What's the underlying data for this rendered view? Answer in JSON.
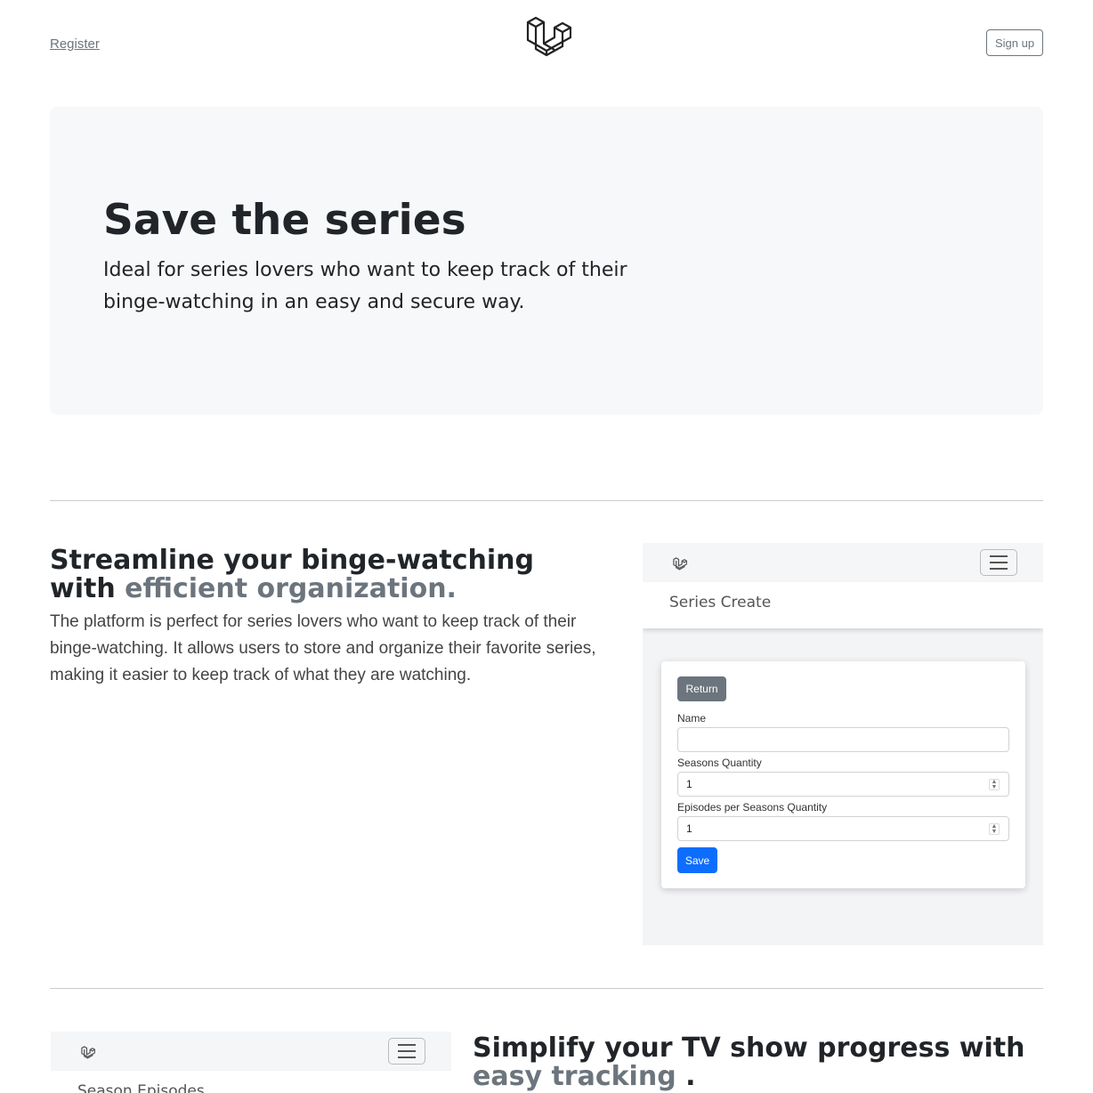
{
  "header": {
    "register_label": "Register",
    "signup_label": "Sign up",
    "logo_icon": "laravel-logo-icon"
  },
  "hero": {
    "title": "Save the series",
    "subtitle": "Ideal for series lovers who want to keep track of their binge-watching in an easy and secure way.",
    "background": "#f7f8f9"
  },
  "feature1": {
    "heading_main": "Streamline your binge-watching with ",
    "heading_muted": "efficient organization.",
    "text": "The platform is perfect for series lovers who want to keep track of their binge-watching. It allows users to store and organize their favorite series, making it easier to keep track of what they are watching.",
    "mock": {
      "page_title": "Series Create",
      "return_label": "Return",
      "name_label": "Name",
      "name_value": "",
      "seasons_label": "Seasons Quantity",
      "seasons_value": "1",
      "episodes_label": "Episodes per Seasons Quantity",
      "episodes_value": "1",
      "save_label": "Save"
    }
  },
  "feature2": {
    "heading_main": "Simplify your TV show progress with ",
    "heading_muted": "easy tracking",
    "heading_end": " .",
    "mock": {
      "page_title": "Season Episodes"
    }
  },
  "colors": {
    "primary": "#0d6efd",
    "secondary": "#6c757d",
    "muted_text": "#6c757d"
  }
}
